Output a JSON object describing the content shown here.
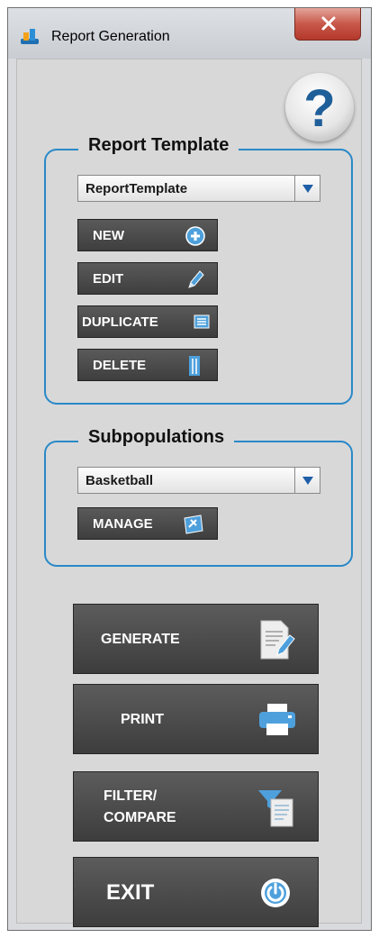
{
  "window": {
    "title": "Report Generation",
    "app_icon": "app-logo-icon",
    "close_icon": "close-icon"
  },
  "help": {
    "label": "?",
    "icon": "help-icon"
  },
  "report_template": {
    "title": "Report Template",
    "selected": "ReportTemplate",
    "buttons": {
      "new": "NEW",
      "edit": "EDIT",
      "duplicate": "DUPLICATE",
      "delete": "DELETE"
    }
  },
  "subpopulations": {
    "title": "Subpopulations",
    "selected": "Basketball",
    "manage": "MANAGE"
  },
  "actions": {
    "generate": "GENERATE",
    "print": "PRINT",
    "filter_line1": "FILTER/",
    "filter_line2": "COMPARE",
    "exit": "EXIT"
  },
  "colors": {
    "accent": "#2a89c8",
    "button_bg": "#4a4a4a",
    "panel_bg": "#d8d8d8",
    "close_red": "#c7584a"
  }
}
